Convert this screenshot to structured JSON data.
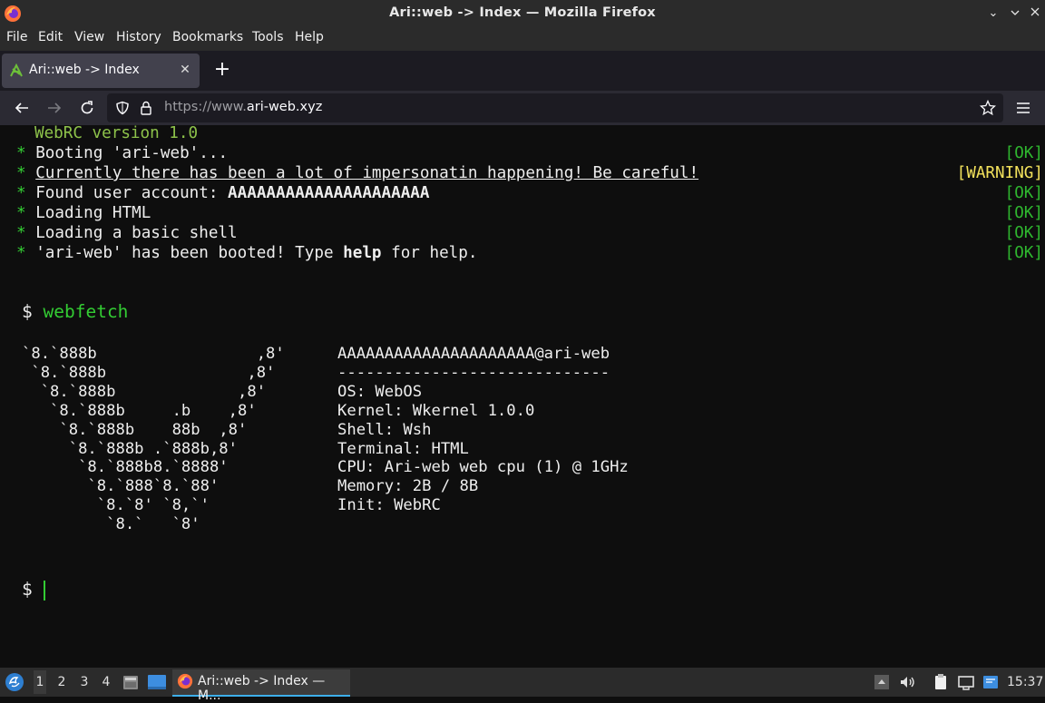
{
  "window": {
    "title": "Ari::web -> Index — Mozilla Firefox"
  },
  "menu": [
    "File",
    "Edit",
    "View",
    "History",
    "Bookmarks",
    "Tools",
    "Help"
  ],
  "tab": {
    "title": "Ari::web -> Index"
  },
  "url": {
    "scheme": "https://www.",
    "host": "ari-web.xyz"
  },
  "terminal": {
    "version": "WebRC version 1.0",
    "bullet": "*",
    "boot_lines": [
      {
        "pre": "Booting 'ari-web'...",
        "bold": "",
        "post": "",
        "status": "[OK]"
      },
      {
        "pre": "Currently there has been a lot of impersonatin happening! Be careful!",
        "bold": "",
        "post": "",
        "status": "[WARNING]"
      },
      {
        "pre": "Found user account: ",
        "bold": "AAAAAAAAAAAAAAAAAAAAA",
        "post": "",
        "status": "[OK]"
      },
      {
        "pre": "Loading HTML",
        "bold": "",
        "post": "",
        "status": "[OK]"
      },
      {
        "pre": "Loading a basic shell",
        "bold": "",
        "post": "",
        "status": "[OK]"
      },
      {
        "pre": "'ari-web' has been booted! Type ",
        "bold": "help",
        "post": " for help.",
        "status": "[OK]"
      }
    ],
    "prompt_symbol": "$",
    "command": "webfetch",
    "ascii_art": "`8.`888b                 ,8'\n `8.`888b               ,8'\n  `8.`888b             ,8'\n   `8.`888b     .b    ,8'\n    `8.`888b    88b  ,8'\n     `8.`888b .`888b,8'\n      `8.`888b8.`8888'\n       `8.`888`8.`88'\n        `8.`8' `8,`'\n         `8.`   `8'",
    "fetch": {
      "user_host": "AAAAAAAAAAAAAAAAAAAAA@ari-web",
      "separator": "-----------------------------",
      "os": "OS: WebOS",
      "kernel": "Kernel: Wkernel 1.0.0",
      "shell": "Shell: Wsh",
      "terminal": "Terminal: HTML",
      "cpu": "CPU: Ari-web web cpu (1) @ 1GHz",
      "memory": "Memory: 2B / 8B",
      "init": "Init: WebRC"
    }
  },
  "taskbar": {
    "workspaces": [
      "1",
      "2",
      "3",
      "4"
    ],
    "task_title": "Ari::web -> Index — M...",
    "clock": "15:37"
  },
  "colors": {
    "prompt_green": "#33cc33",
    "ok_green": "#2fb82f",
    "warning_yellow": "#f3e25c",
    "accent_blue": "#3daee9"
  }
}
